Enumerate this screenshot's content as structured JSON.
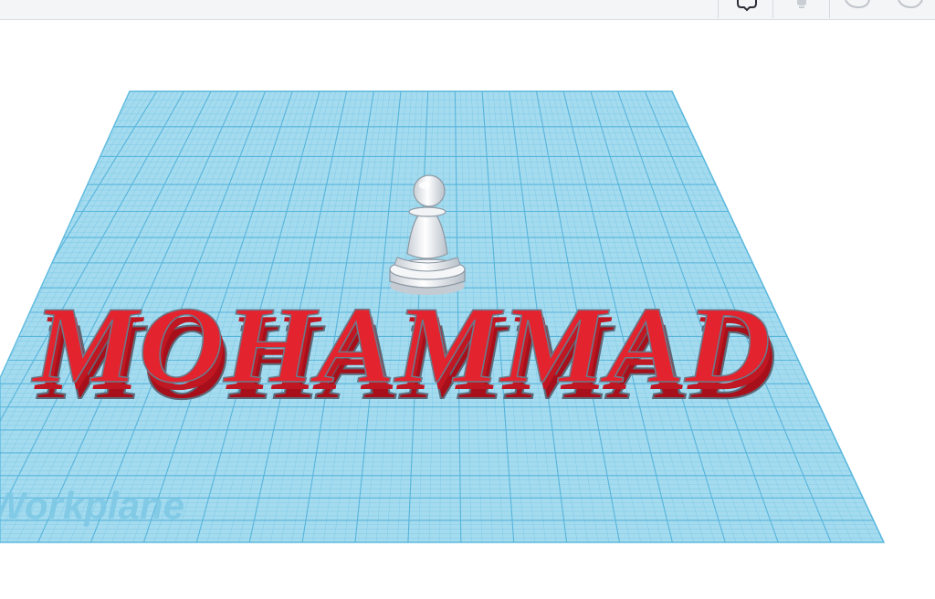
{
  "toolbar": {
    "buttons": [
      {
        "icon": "notes-icon"
      },
      {
        "icon": "light-bulb-icon"
      },
      {
        "icon": "undo-icon"
      },
      {
        "icon": "redo-icon"
      }
    ]
  },
  "scene": {
    "workplane_label": "Workplane",
    "text_shape": "MOHAMMAD",
    "colors": {
      "grid_fill": "#9fd8ee",
      "grid_line": "#5bb8dc",
      "text_face": "#e3222d",
      "text_side": "#b5121d",
      "pawn": "#e9ecef"
    }
  }
}
